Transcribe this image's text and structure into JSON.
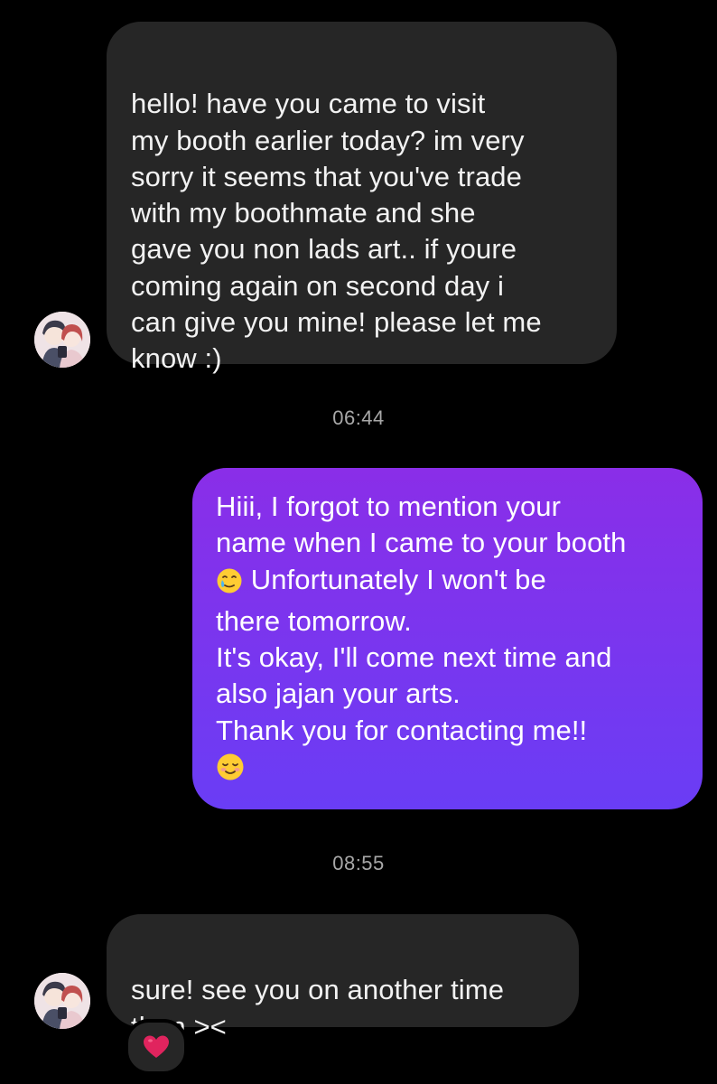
{
  "colors": {
    "background": "#000000",
    "incoming_bubble": "#262626",
    "outgoing_gradient_top": "#8a2ee8",
    "outgoing_gradient_bottom": "#6a3df5",
    "timestamp_text": "#a8a8a8",
    "heart": "#e0245e"
  },
  "conversation": {
    "messages": [
      {
        "id": "msg1",
        "sender": "other",
        "text": "hello! have you came to visit\nmy booth earlier today? im very\nsorry it seems that you've trade\nwith my boothmate and she\ngave you non lads art.. if youre\ncoming again on second day i\ncan give you mine! please let me\nknow :)"
      },
      {
        "id": "msg2",
        "sender": "me",
        "line1": "Hiii, I forgot to mention your",
        "line2": "name when I came to your booth",
        "line3_after_emoji": " Unfortunately I won't be",
        "line4": "there tomorrow.",
        "line5": "It's okay, I'll come next time and",
        "line6": "also jajan your arts.",
        "line7": "Thank you for contacting me!!",
        "emoji_1": "face-holding-back-tears-icon",
        "emoji_2": "smiling-face-icon"
      },
      {
        "id": "msg3",
        "sender": "other",
        "text": "sure! see you on another time\nthen ><",
        "reaction": "red-heart-icon"
      }
    ],
    "timestamps": [
      "06:44",
      "08:55"
    ]
  }
}
